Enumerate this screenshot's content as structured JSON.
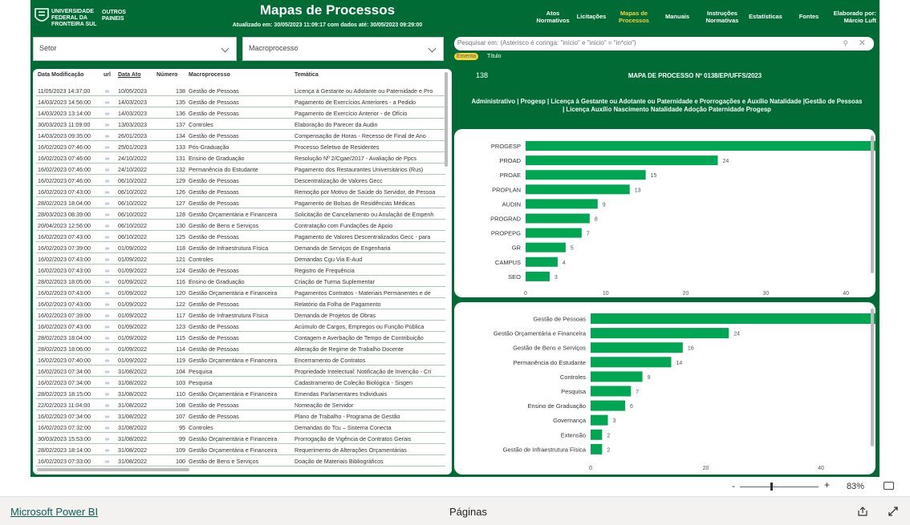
{
  "header": {
    "university": "UNIVERSIDADE FEDERAL DA FRONTEIRA SUL",
    "outros": "OUTROS PAINEIS",
    "title": "Mapas de Processos",
    "updated": "Atualizado em: 30/05/2023 11:09:17 com dados até: 30/05/2023 09:29:00",
    "nav": [
      {
        "label": "Atos Normativos",
        "active": false
      },
      {
        "label": "Licitações",
        "active": false
      },
      {
        "label": "Mapas de Processos",
        "active": true
      },
      {
        "label": "Manuais",
        "active": false
      },
      {
        "label": "Instruções Normativas",
        "active": false
      },
      {
        "label": "Estatísticas",
        "active": false
      },
      {
        "label": "Fontes",
        "active": false
      }
    ],
    "elaborado": "Elaborado por: Márcio Luft"
  },
  "filters": {
    "setor": "Setor",
    "macroprocesso": "Macroprocesso",
    "search_placeholder": "Pesquisar em: (Asterisco é coringa: \"início\" e \"inicio\" = \"in*cio\")",
    "chip_on": "Ementa",
    "chip_off": "Título"
  },
  "table": {
    "headers": [
      "Data Modificação",
      "url",
      "Data Ato",
      "Número",
      "Macroprocesso",
      "Temática"
    ],
    "link_icon": "link-icon",
    "rows": [
      [
        "11/05/2023 14:37:00",
        "10/05/2023",
        "138",
        "Gestão de Pessoas",
        "Licença à Gestante ou Adotante ou Paternidade e Pro"
      ],
      [
        "14/03/2023 14:56:00",
        "14/03/2023",
        "135",
        "Gestão de Pessoas",
        "Pagamento de Exercícios Anteriores - a Pedido"
      ],
      [
        "14/03/2023 13:14:00",
        "14/03/2023",
        "136",
        "Gestão de Pessoas",
        "Pagamento de Exercício Anterior - de Ofício"
      ],
      [
        "30/03/2023 11:09:00",
        "13/03/2023",
        "137",
        "Controles",
        "Elaboração do Parecer da Audin"
      ],
      [
        "14/03/2023 09:35:00",
        "26/01/2023",
        "134",
        "Gestão de Pessoas",
        "Compensação de Horas - Recesso de Final de Ano"
      ],
      [
        "16/02/2023 07:46:00",
        "25/01/2023",
        "133",
        "Pós-Graduação",
        "Processo Seletivo de Residentes"
      ],
      [
        "16/02/2023 07:46:00",
        "24/10/2022",
        "131",
        "Ensino de Graduação",
        "Resolução Nº 2/Cgae/2017 - Avaliação de Ppcs"
      ],
      [
        "16/02/2023 07:46:00",
        "24/10/2022",
        "132",
        "Permanência do Estudante",
        "Pagamento dos Restaurantes Universitários (Rus)"
      ],
      [
        "16/02/2023 07:46:00",
        "06/10/2022",
        "129",
        "Gestão de Pessoas",
        "Descentralização de Valores Gecc"
      ],
      [
        "16/02/2023 07:43:00",
        "06/10/2022",
        "126",
        "Gestão de Pessoas",
        "Remoção por Motivo de Saúde do Servidor, de Pessoa"
      ],
      [
        "28/02/2023 18:04:00",
        "06/10/2022",
        "127",
        "Gestão de Pessoas",
        "Pagamento de Bolsas de Residências Médicas"
      ],
      [
        "28/03/2023 08:39:00",
        "06/10/2022",
        "128",
        "Gestão Orçamentária e Financeira",
        "Solicitação de Cancelamento ou Anulação de Empenh"
      ],
      [
        "20/04/2023 12:56:00",
        "06/10/2022",
        "130",
        "Gestão de Bens e Serviços",
        "Contratação com Fundações de Apoio"
      ],
      [
        "16/02/2023 07:43:00",
        "06/10/2022",
        "125",
        "Gestão de Pessoas",
        "Pagamento de Valores Descentralizados Gecc - para"
      ],
      [
        "16/02/2023 07:39:00",
        "01/09/2022",
        "118",
        "Gestão de Infraestrutura Física",
        "Demanda de Serviços de Engenharia"
      ],
      [
        "16/02/2023 07:43:00",
        "01/09/2022",
        "121",
        "Controles",
        "Demandas Cgu Via E-Aud"
      ],
      [
        "16/02/2023 07:43:00",
        "01/09/2022",
        "124",
        "Gestão de Pessoas",
        "Registro de Frequência"
      ],
      [
        "28/02/2023 18:05:00",
        "01/09/2022",
        "116",
        "Ensino de Graduação",
        "Criação de Turma Suplementar"
      ],
      [
        "16/02/2023 07:43:00",
        "01/09/2022",
        "120",
        "Gestão Orçamentária e Financeira",
        "Pagamentos Contratos - Materiais Permanentes e de"
      ],
      [
        "16/02/2023 07:43:00",
        "01/09/2022",
        "122",
        "Gestão de Pessoas",
        "Relatório da Folha de Pagamento"
      ],
      [
        "16/02/2023 07:39:00",
        "01/09/2022",
        "117",
        "Gestão de Infraestrutura Física",
        "Demanda de Projetos de Obras"
      ],
      [
        "16/02/2023 07:43:00",
        "01/09/2022",
        "123",
        "Gestão de Pessoas",
        "Acúmulo de Cargos, Empregos ou Função Pública"
      ],
      [
        "28/02/2023 18:04:00",
        "01/09/2022",
        "115",
        "Gestão de Pessoas",
        "Contagem e Averbação de Tempo de Contribuição"
      ],
      [
        "28/02/2023 18:06:00",
        "01/09/2022",
        "114",
        "Gestão de Pessoas",
        "Alteração de Regime de Trabalho Docente"
      ],
      [
        "16/02/2023 07:40:00",
        "01/09/2022",
        "119",
        "Gestão Orçamentária e Financeira",
        "Encerramento de Contratos"
      ],
      [
        "16/02/2023 07:34:00",
        "31/08/2022",
        "104",
        "Pesquisa",
        "Propriedade Intelectual: Notificação de Invenção - Cri"
      ],
      [
        "16/02/2023 07:34:00",
        "31/08/2022",
        "103",
        "Pesquisa",
        "Cadastramento de Coleção Biológica - Sisgen"
      ],
      [
        "28/02/2023 18:15:00",
        "31/08/2022",
        "110",
        "Gestão Orçamentária e Financeira",
        "Emendas Parlamentares Individuais"
      ],
      [
        "22/02/2023 11:04:00",
        "31/08/2022",
        "108",
        "Gestão de Pessoas",
        "Nomeação de Servidor"
      ],
      [
        "16/02/2023 07:34:00",
        "31/08/2022",
        "107",
        "Gestão de Pessoas",
        "Plano de Trabalho - Programa de Gestão"
      ],
      [
        "16/02/2023 07:32:00",
        "31/08/2022",
        "95",
        "Controles",
        "Demandas do Tcu – Sistema Conecta"
      ],
      [
        "30/03/2023 15:53:00",
        "31/08/2022",
        "99",
        "Gestão Orçamentária e Financeira",
        "Prorrogação de Vigência de Contratos Gerais"
      ],
      [
        "28/02/2023 18:14:00",
        "31/08/2022",
        "109",
        "Gestão Orçamentária e Financeira",
        "Requerimento de Alterações Orçamentárias"
      ],
      [
        "16/02/2023 07:33:00",
        "31/08/2022",
        "100",
        "Gestão de Bens e Serviços",
        "Doação de Materiais Bibliográficos"
      ]
    ]
  },
  "detail": {
    "number": "138",
    "mapa": "MAPA DE PROCESSO Nº 0138/EP/UFFS/2023",
    "description": "Administrativo | Progesp | Licença à Gestante ou Adotante ou Paternidade e Prorrogações e Auxílio Natalidade |Gestão de Pessoas | Licença Auxílio Nascimento Natalidade Adoção Paternidade Progesp"
  },
  "chart_data": [
    {
      "type": "bar",
      "orientation": "horizontal",
      "categories": [
        "PROGESP",
        "PROAD",
        "PROAE",
        "PROPLAN",
        "AUDIN",
        "PROGRAD",
        "PROPEPG",
        "GR",
        "CAMPUS",
        "SEO"
      ],
      "values": [
        45,
        24,
        15,
        13,
        9,
        8,
        7,
        5,
        4,
        3
      ],
      "xticks": [
        0,
        10,
        20,
        30,
        40
      ],
      "xlim": [
        0,
        45
      ],
      "color": "#00a651"
    },
    {
      "type": "bar",
      "orientation": "horizontal",
      "categories": [
        "Gestão de Pessoas",
        "Gestão Orçamentária e Financeira",
        "Gestão de Bens e Serviços",
        "Permanência do Estudante",
        "Controles",
        "Pesquisa",
        "Ensino de Graduação",
        "Governança",
        "Extensão",
        "Gestão de Infraestrutura Física"
      ],
      "values": [
        51,
        24,
        16,
        14,
        9,
        7,
        6,
        3,
        2,
        2
      ],
      "xticks": [
        0,
        20,
        40
      ],
      "xlim": [
        0,
        51
      ],
      "color": "#00a651"
    }
  ],
  "zoom": {
    "minus": "-",
    "plus": "+",
    "level": "83%"
  },
  "footer": {
    "brand": "Microsoft Power BI",
    "pages": "Páginas"
  },
  "colors": {
    "primary": "#006b34",
    "bar": "#00a651",
    "accent": "#f5d53d"
  }
}
